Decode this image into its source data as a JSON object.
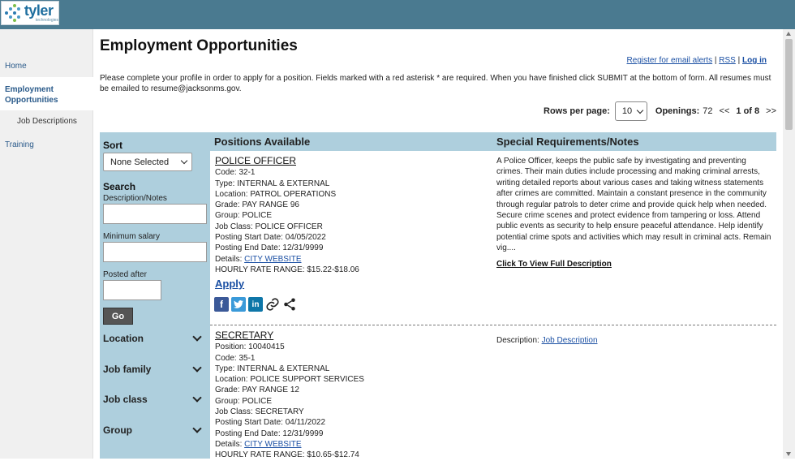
{
  "logo": {
    "word": "tyler",
    "sub": "technologies"
  },
  "nav": {
    "home": "Home",
    "employment": "Employment Opportunities",
    "job_descriptions": "Job Descriptions",
    "training": "Training"
  },
  "page": {
    "title": "Employment Opportunities",
    "links": {
      "email_alerts": "Register for email alerts",
      "rss": "RSS",
      "login": "Log in"
    },
    "intro": "Please complete your profile in order to apply for a position. Fields marked with a red asterisk * are required. When you have finished click SUBMIT at the bottom of form. All resumes must be emailed to resume@jacksonms.gov."
  },
  "pager": {
    "rows_label": "Rows per page:",
    "rows_value": "10",
    "openings_label": "Openings:",
    "openings": "72",
    "prev": "<<",
    "page": "1 of 8",
    "next": ">>"
  },
  "filters": {
    "sort_title": "Sort",
    "sort_value": "None Selected",
    "search_title": "Search",
    "desc_label": "Description/Notes",
    "salary_label": "Minimum salary",
    "posted_label": "Posted after",
    "go": "Go",
    "accordions": [
      "Location",
      "Job family",
      "Job class",
      "Group"
    ]
  },
  "table": {
    "col_positions": "Positions Available",
    "col_notes": "Special Requirements/Notes"
  },
  "positions": [
    {
      "title": "POLICE OFFICER",
      "lines": [
        "Code: 32-1",
        "Type: INTERNAL & EXTERNAL",
        "Location: PATROL OPERATIONS",
        "Grade: PAY RANGE 96",
        "Group: POLICE",
        "Job Class: POLICE OFFICER",
        "Posting Start Date: 04/05/2022",
        "Posting End Date: 12/31/9999"
      ],
      "details_label": "Details: ",
      "details_link": "CITY WEBSITE",
      "rate": "HOURLY RATE RANGE: $15.22-$18.06",
      "apply": "Apply",
      "notes": "A Police Officer, keeps the public safe by investigating and preventing crimes. Their main duties include processing and making criminal arrests, writing detailed reports about various cases and taking witness statements after crimes are committed. Maintain a constant presence in the community through regular patrols to deter crime and provide quick help when needed. Secure crime scenes and protect evidence from tampering or loss. Attend public events as security to help ensure peaceful attendance. Help identify potential crime spots and activities which may result in criminal acts. Remain vig....",
      "full_desc": "Click To View Full Description"
    },
    {
      "title": "SECRETARY",
      "lines": [
        "Position: 10040415",
        "Code: 35-1",
        "Type: INTERNAL & EXTERNAL",
        "Location: POLICE SUPPORT SERVICES",
        "Grade: PAY RANGE 12",
        "Group: POLICE",
        "Job Class: SECRETARY",
        "Posting Start Date: 04/11/2022",
        "Posting End Date: 12/31/9999"
      ],
      "details_label": "Details: ",
      "details_link": "CITY WEBSITE",
      "rate": "HOURLY RATE RANGE: $10.65-$12.74",
      "desc_label": "Description: ",
      "desc_link": "Job Description"
    }
  ],
  "share_icons": [
    "facebook-icon",
    "twitter-icon",
    "linkedin-icon",
    "link-icon",
    "share-icon"
  ],
  "colors": {
    "topbar": "#4a7a90",
    "filter_bg": "#aecfdd",
    "link": "#1a4fa3"
  }
}
